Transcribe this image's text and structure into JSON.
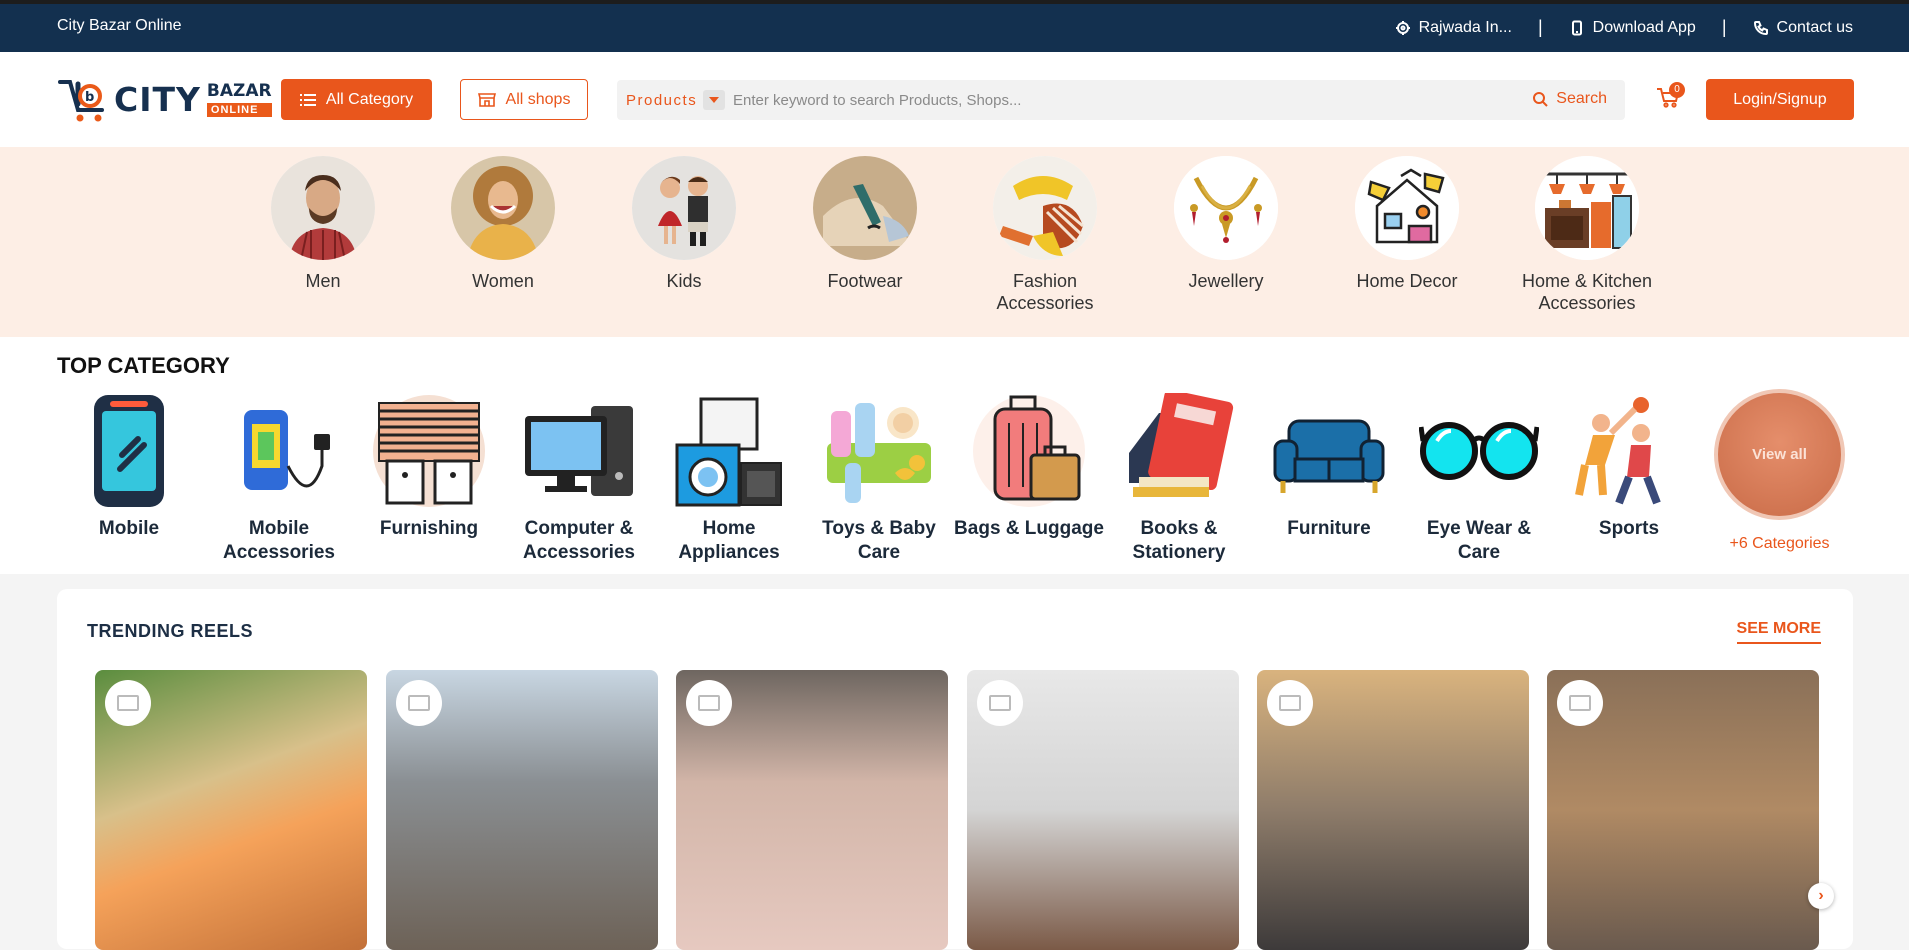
{
  "topbar": {
    "brand": "City Bazar Online",
    "location": "Rajwada In...",
    "download": "Download App",
    "contact": "Contact us",
    "separator": "|"
  },
  "header": {
    "logo": {
      "city": "CITY",
      "bazar": "BAZAR",
      "online": "ONLINE"
    },
    "all_category": "All Category",
    "all_shops": "All shops",
    "search_type": "Products",
    "search_placeholder": "Enter keyword to search Products, Shops...",
    "search_button": "Search",
    "cart_count": "0",
    "login": "Login/Signup"
  },
  "categories": [
    {
      "label": "Men",
      "icon": "men-photo"
    },
    {
      "label": "Women",
      "icon": "women-photo"
    },
    {
      "label": "Kids",
      "icon": "kids-photo"
    },
    {
      "label": "Footwear",
      "icon": "footwear-photo"
    },
    {
      "label": "Fashion Accessories",
      "icon": "fashion-accessories-photo"
    },
    {
      "label": "Jewellery",
      "icon": "necklace-icon"
    },
    {
      "label": "Home Decor",
      "icon": "home-decor-icon"
    },
    {
      "label": "Home & Kitchen Accessories",
      "icon": "kitchen-icon"
    }
  ],
  "top_category": {
    "title": "TOP CATEGORY",
    "items": [
      {
        "label": "Mobile",
        "icon": "mobile-icon"
      },
      {
        "label": "Mobile Accessories",
        "icon": "charger-icon"
      },
      {
        "label": "Furnishing",
        "icon": "blinds-icon"
      },
      {
        "label": "Computer & Accessories",
        "icon": "computer-icon"
      },
      {
        "label": "Home Appliances",
        "icon": "washing-machine-icon"
      },
      {
        "label": "Toys & Baby Care",
        "icon": "baby-care-icon"
      },
      {
        "label": "Bags & Luggage",
        "icon": "luggage-icon"
      },
      {
        "label": "Books & Stationery",
        "icon": "books-icon"
      },
      {
        "label": "Furniture",
        "icon": "sofa-icon"
      },
      {
        "label": "Eye Wear & Care",
        "icon": "glasses-icon"
      },
      {
        "label": "Sports",
        "icon": "basketball-players-icon"
      }
    ],
    "view_all": "View all",
    "more": "+6 Categories"
  },
  "reels": {
    "title": "TRENDING REELS",
    "see_more": "SEE MORE",
    "items": [
      {
        "name": "reel-handicraft-store",
        "bg": "#c89a6e"
      },
      {
        "name": "reel-street-market",
        "bg": "#8f9aa3"
      },
      {
        "name": "reel-ethnic-boutique",
        "bg": "#b4a49a"
      },
      {
        "name": "reel-mobile-store",
        "bg": "#dcdcdc"
      },
      {
        "name": "reel-bookstore",
        "bg": "#a8927b"
      },
      {
        "name": "reel-warehouse",
        "bg": "#8d7a66"
      }
    ],
    "next_arrow": "›"
  },
  "colors": {
    "accent": "#e9561c",
    "navy": "#13304f",
    "strip": "#fdeee5"
  }
}
